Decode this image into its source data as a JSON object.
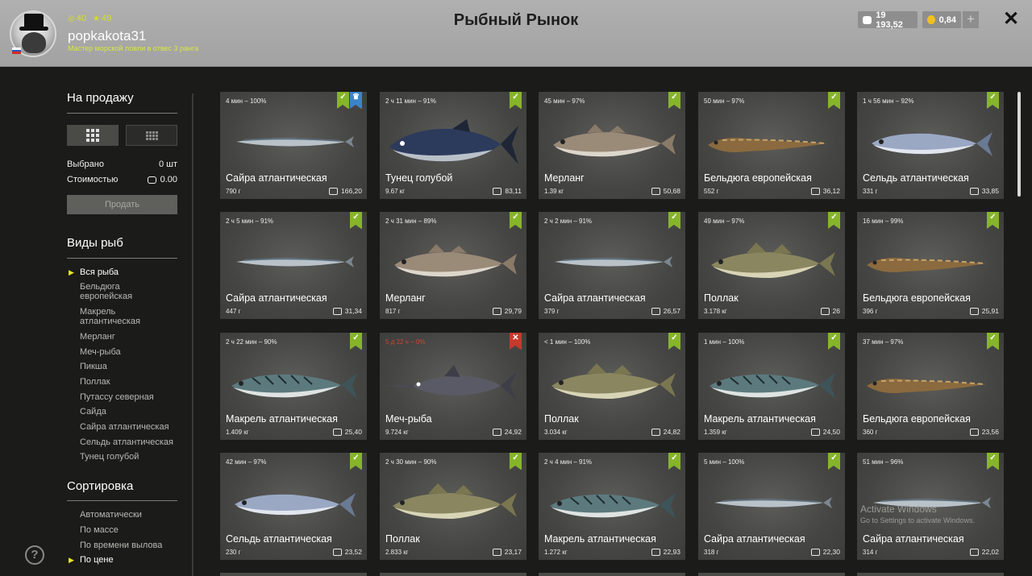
{
  "header": {
    "title": "Рыбный Рынок",
    "username": "popkakota31",
    "rank_subtitle": "Мастер морской ловли в отвес 3 ранга",
    "level": "40",
    "stars": "49",
    "silver": "19 193,52",
    "gold": "0,84",
    "plus": "+",
    "close": "✕"
  },
  "sidebar": {
    "sale_title": "На продажу",
    "selected_label": "Выбрано",
    "selected_value": "0 шт",
    "cost_label": "Стоимостью",
    "cost_value": "0.00",
    "sell_button": "Продать",
    "species_title": "Виды рыб",
    "species": [
      "Вся рыба",
      "Бельдюга европейская",
      "Макрель атлантическая",
      "Мерланг",
      "Меч-рыба",
      "Пикша",
      "Поллак",
      "Путассу северная",
      "Сайда",
      "Сайра атлантическая",
      "Сельдь атлантическая",
      "Тунец голубой"
    ],
    "sort_title": "Сортировка",
    "sort": [
      "Автоматически",
      "По массе",
      "По времени вылова",
      "По цене"
    ],
    "help": "?"
  },
  "cards": [
    {
      "time": "4 мин – 100%",
      "name": "Сайра атлантическая",
      "weight": "790 г",
      "price": "166,20",
      "badge": "green",
      "extra_badge": "blue",
      "fish": "saury"
    },
    {
      "time": "2 ч 11 мин – 91%",
      "name": "Тунец голубой",
      "weight": "9.67 кг",
      "price": "83,11",
      "badge": "green",
      "fish": "tuna"
    },
    {
      "time": "45 мин – 97%",
      "name": "Мерланг",
      "weight": "1.39 кг",
      "price": "50,68",
      "badge": "green",
      "fish": "whiting"
    },
    {
      "time": "50 мин – 97%",
      "name": "Бельдюга европейская",
      "weight": "552 г",
      "price": "36,12",
      "badge": "green",
      "fish": "eelpout"
    },
    {
      "time": "1 ч 56 мин – 92%",
      "name": "Сельдь атлантическая",
      "weight": "331 г",
      "price": "33,85",
      "badge": "green",
      "fish": "herring"
    },
    {
      "time": "2 ч 5 мин – 91%",
      "name": "Сайра атлантическая",
      "weight": "447 г",
      "price": "31,34",
      "badge": "green",
      "fish": "saury"
    },
    {
      "time": "2 ч 31 мин – 89%",
      "name": "Мерланг",
      "weight": "817 г",
      "price": "29,79",
      "badge": "green",
      "fish": "whiting"
    },
    {
      "time": "2 ч 2 мин – 91%",
      "name": "Сайра атлантическая",
      "weight": "379 г",
      "price": "26,57",
      "badge": "green",
      "fish": "saury"
    },
    {
      "time": "49 мин – 97%",
      "name": "Поллак",
      "weight": "3.178 кг",
      "price": "26",
      "badge": "green",
      "fish": "pollack"
    },
    {
      "time": "16 мин – 99%",
      "name": "Бельдюга европейская",
      "weight": "396 г",
      "price": "25,91",
      "badge": "green",
      "fish": "eelpout"
    },
    {
      "time": "2 ч 22 мин – 90%",
      "name": "Макрель атлантическая",
      "weight": "1.409 кг",
      "price": "25,40",
      "badge": "green",
      "fish": "mackerel"
    },
    {
      "time": "5 д 22 ч – 0%",
      "name": "Меч-рыба",
      "weight": "9.724 кг",
      "price": "24,92",
      "badge": "red",
      "time_red": true,
      "fish": "swordfish"
    },
    {
      "time": "< 1 мин – 100%",
      "name": "Поллак",
      "weight": "3.034 кг",
      "price": "24,82",
      "badge": "green",
      "fish": "pollack"
    },
    {
      "time": "1 мин – 100%",
      "name": "Макрель атлантическая",
      "weight": "1.359 кг",
      "price": "24,50",
      "badge": "green",
      "fish": "mackerel"
    },
    {
      "time": "37 мин – 97%",
      "name": "Бельдюга европейская",
      "weight": "360 г",
      "price": "23,56",
      "badge": "green",
      "fish": "eelpout"
    },
    {
      "time": "42 мин – 97%",
      "name": "Сельдь атлантическая",
      "weight": "230 г",
      "price": "23,52",
      "badge": "green",
      "fish": "herring"
    },
    {
      "time": "2 ч 30 мин – 90%",
      "name": "Поллак",
      "weight": "2.833 кг",
      "price": "23,17",
      "badge": "green",
      "fish": "pollack"
    },
    {
      "time": "2 ч 4 мин – 91%",
      "name": "Макрель атлантическая",
      "weight": "1.272 кг",
      "price": "22,93",
      "badge": "green",
      "fish": "mackerel"
    },
    {
      "time": "5 мин – 100%",
      "name": "Сайра атлантическая",
      "weight": "318 г",
      "price": "22,30",
      "badge": "green",
      "fish": "saury"
    },
    {
      "time": "51 мин – 96%",
      "name": "Сайра атлантическая",
      "weight": "314 г",
      "price": "22,02",
      "badge": "green",
      "fish": "saury"
    }
  ],
  "watermark": {
    "line1": "Activate Windows",
    "line2": "Go to Settings to activate Windows."
  },
  "colors": {
    "accent_yellow": "#d8e640",
    "badge_green": "#86b52a",
    "badge_blue": "#3b84c8",
    "badge_red": "#c43a2c",
    "card_bg": "#454543"
  }
}
